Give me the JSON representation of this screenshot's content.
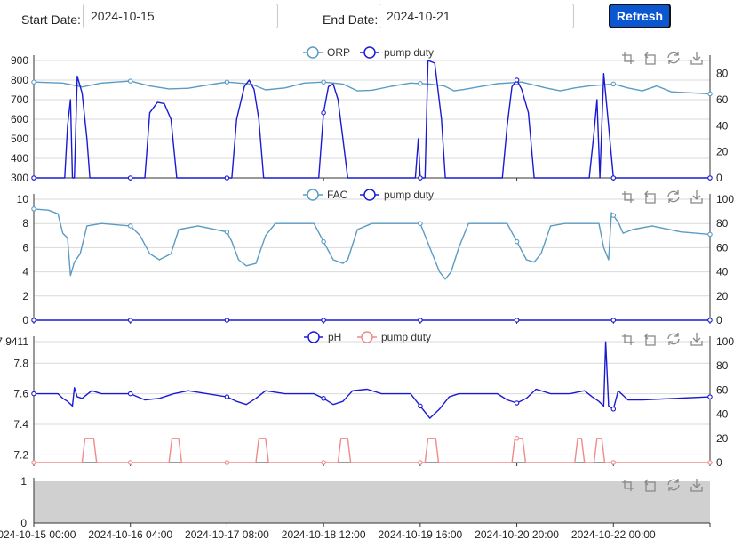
{
  "controls": {
    "start_label": "Start Date:",
    "start_value": "2024-10-15",
    "end_label": "End Date:",
    "end_value": "2024-10-21",
    "refresh_label": "Refresh"
  },
  "colors": {
    "orp": "#5b9bc4",
    "fac": "#5b9bc4",
    "ph": "#1a1ad4",
    "pump_blue": "#1a1ad4",
    "pump_pink": "#f08a8a",
    "grid": "#d9d9d9",
    "slider_fill": "#d0d0d0",
    "toolbox": "#888888"
  },
  "toolbox_icons": [
    "zoom-icon",
    "zoom-reset-icon",
    "restore-icon",
    "save-image-icon"
  ],
  "chart_data": [
    {
      "type": "line",
      "legend": [
        "ORP",
        "pump duty"
      ],
      "y_left_ticks": [
        "900",
        "800",
        "700",
        "600",
        "500",
        "400",
        "300"
      ],
      "y_left_range": [
        300,
        900
      ],
      "y_right_ticks": [
        "80",
        "60",
        "40",
        "20",
        "0"
      ],
      "y_right_range": [
        0,
        90
      ],
      "series": [
        {
          "name": "ORP",
          "axis": "left",
          "color": "#5b9bc4",
          "points": [
            [
              0,
              790
            ],
            [
              0.3,
              785
            ],
            [
              0.5,
              765
            ],
            [
              0.7,
              785
            ],
            [
              1,
              795
            ],
            [
              1.2,
              770
            ],
            [
              1.4,
              755
            ],
            [
              1.6,
              758
            ],
            [
              1.8,
              775
            ],
            [
              2,
              790
            ],
            [
              2.25,
              780
            ],
            [
              2.4,
              750
            ],
            [
              2.6,
              760
            ],
            [
              2.8,
              785
            ],
            [
              3,
              790
            ],
            [
              3.2,
              780
            ],
            [
              3.35,
              745
            ],
            [
              3.5,
              748
            ],
            [
              3.7,
              768
            ],
            [
              3.9,
              785
            ],
            [
              4.1,
              780
            ],
            [
              4.25,
              770
            ],
            [
              4.35,
              745
            ],
            [
              4.45,
              752
            ],
            [
              4.6,
              765
            ],
            [
              4.8,
              782
            ],
            [
              5.05,
              790
            ],
            [
              5.3,
              760
            ],
            [
              5.45,
              745
            ],
            [
              5.6,
              760
            ],
            [
              5.75,
              770
            ],
            [
              6,
              780
            ],
            [
              6.15,
              760
            ],
            [
              6.3,
              745
            ],
            [
              6.45,
              770
            ],
            [
              6.6,
              740
            ],
            [
              6.8,
              735
            ],
            [
              7,
              730
            ]
          ]
        },
        {
          "name": "pump duty",
          "axis": "right",
          "color": "#1a1ad4",
          "points": [
            [
              0,
              0
            ],
            [
              0.32,
              0
            ],
            [
              0.35,
              40
            ],
            [
              0.38,
              60
            ],
            [
              0.4,
              0
            ],
            [
              0.42,
              0
            ],
            [
              0.45,
              78
            ],
            [
              0.5,
              65
            ],
            [
              0.55,
              30
            ],
            [
              0.58,
              0
            ],
            [
              1.15,
              0
            ],
            [
              1.2,
              50
            ],
            [
              1.28,
              58
            ],
            [
              1.35,
              57
            ],
            [
              1.42,
              45
            ],
            [
              1.48,
              0
            ],
            [
              2.05,
              0
            ],
            [
              2.1,
              45
            ],
            [
              2.18,
              70
            ],
            [
              2.23,
              75
            ],
            [
              2.28,
              68
            ],
            [
              2.33,
              45
            ],
            [
              2.38,
              0
            ],
            [
              2.95,
              0
            ],
            [
              3.0,
              50
            ],
            [
              3.05,
              70
            ],
            [
              3.1,
              72
            ],
            [
              3.15,
              60
            ],
            [
              3.2,
              30
            ],
            [
              3.25,
              0
            ],
            [
              3.95,
              0
            ],
            [
              3.98,
              30
            ],
            [
              4.0,
              0
            ],
            [
              4.05,
              0
            ],
            [
              4.08,
              90
            ],
            [
              4.15,
              88
            ],
            [
              4.18,
              70
            ],
            [
              4.22,
              45
            ],
            [
              4.26,
              0
            ],
            [
              4.85,
              0
            ],
            [
              4.9,
              40
            ],
            [
              4.95,
              70
            ],
            [
              5.0,
              75
            ],
            [
              5.05,
              68
            ],
            [
              5.12,
              50
            ],
            [
              5.18,
              0
            ],
            [
              5.75,
              0
            ],
            [
              5.8,
              35
            ],
            [
              5.83,
              60
            ],
            [
              5.86,
              0
            ],
            [
              5.9,
              80
            ],
            [
              5.95,
              40
            ],
            [
              6.0,
              0
            ],
            [
              7,
              0
            ]
          ]
        }
      ]
    },
    {
      "type": "line",
      "legend": [
        "FAC",
        "pump duty"
      ],
      "y_left_ticks": [
        "10",
        "8",
        "6",
        "4",
        "2",
        "0"
      ],
      "y_left_range": [
        0,
        10
      ],
      "y_right_ticks": [
        "100",
        "80",
        "60",
        "40",
        "20",
        "0"
      ],
      "y_right_range": [
        0,
        100
      ],
      "series": [
        {
          "name": "FAC",
          "axis": "left",
          "color": "#5b9bc4",
          "points": [
            [
              0,
              9.2
            ],
            [
              0.15,
              9.1
            ],
            [
              0.25,
              8.8
            ],
            [
              0.3,
              7.2
            ],
            [
              0.35,
              6.8
            ],
            [
              0.38,
              3.7
            ],
            [
              0.42,
              4.8
            ],
            [
              0.48,
              5.5
            ],
            [
              0.55,
              7.8
            ],
            [
              0.7,
              8.0
            ],
            [
              1,
              7.8
            ],
            [
              1.1,
              7.0
            ],
            [
              1.2,
              5.5
            ],
            [
              1.3,
              5.0
            ],
            [
              1.42,
              5.5
            ],
            [
              1.5,
              7.5
            ],
            [
              1.7,
              7.8
            ],
            [
              2.0,
              7.3
            ],
            [
              2.05,
              6.5
            ],
            [
              2.12,
              5.0
            ],
            [
              2.2,
              4.5
            ],
            [
              2.3,
              4.7
            ],
            [
              2.4,
              7.0
            ],
            [
              2.5,
              8.0
            ],
            [
              2.9,
              8.0
            ],
            [
              3.0,
              6.5
            ],
            [
              3.1,
              5.0
            ],
            [
              3.2,
              4.7
            ],
            [
              3.25,
              5.0
            ],
            [
              3.35,
              7.5
            ],
            [
              3.5,
              8.0
            ],
            [
              4.0,
              8.0
            ],
            [
              4.1,
              6.0
            ],
            [
              4.2,
              4.0
            ],
            [
              4.26,
              3.4
            ],
            [
              4.32,
              4.0
            ],
            [
              4.4,
              6.0
            ],
            [
              4.5,
              8.0
            ],
            [
              4.9,
              8.0
            ],
            [
              5.0,
              6.5
            ],
            [
              5.1,
              5.0
            ],
            [
              5.18,
              4.8
            ],
            [
              5.25,
              5.5
            ],
            [
              5.35,
              7.8
            ],
            [
              5.5,
              8.0
            ],
            [
              5.85,
              8.0
            ],
            [
              5.9,
              6.0
            ],
            [
              5.95,
              5.0
            ],
            [
              5.98,
              8.9
            ],
            [
              6.05,
              8.1
            ],
            [
              6.1,
              7.2
            ],
            [
              6.2,
              7.5
            ],
            [
              6.4,
              7.8
            ],
            [
              6.7,
              7.3
            ],
            [
              7,
              7.1
            ]
          ]
        },
        {
          "name": "pump duty",
          "axis": "right",
          "color": "#1a1ad4",
          "points": [
            [
              0,
              0
            ],
            [
              7,
              0
            ]
          ]
        }
      ]
    },
    {
      "type": "line",
      "legend": [
        "pH",
        "pump duty"
      ],
      "y_left_ticks": [
        "7.9411",
        "7.8",
        "7.6",
        "7.4",
        "7.2"
      ],
      "y_left_range": [
        7.15,
        7.9411
      ],
      "y_right_ticks": [
        "100",
        "80",
        "60",
        "40",
        "20",
        "0"
      ],
      "y_right_range": [
        0,
        100
      ],
      "series": [
        {
          "name": "pH",
          "axis": "left",
          "color": "#1a1ad4",
          "points": [
            [
              0,
              7.6
            ],
            [
              0.25,
              7.6
            ],
            [
              0.3,
              7.57
            ],
            [
              0.35,
              7.55
            ],
            [
              0.4,
              7.52
            ],
            [
              0.42,
              7.64
            ],
            [
              0.45,
              7.58
            ],
            [
              0.5,
              7.57
            ],
            [
              0.6,
              7.62
            ],
            [
              0.7,
              7.6
            ],
            [
              1.0,
              7.6
            ],
            [
              1.15,
              7.56
            ],
            [
              1.3,
              7.57
            ],
            [
              1.45,
              7.6
            ],
            [
              1.6,
              7.62
            ],
            [
              2.0,
              7.58
            ],
            [
              2.1,
              7.55
            ],
            [
              2.2,
              7.53
            ],
            [
              2.3,
              7.57
            ],
            [
              2.4,
              7.62
            ],
            [
              2.6,
              7.6
            ],
            [
              2.9,
              7.6
            ],
            [
              3.0,
              7.57
            ],
            [
              3.1,
              7.53
            ],
            [
              3.2,
              7.55
            ],
            [
              3.3,
              7.62
            ],
            [
              3.45,
              7.63
            ],
            [
              3.6,
              7.6
            ],
            [
              3.9,
              7.6
            ],
            [
              4.0,
              7.52
            ],
            [
              4.1,
              7.44
            ],
            [
              4.2,
              7.5
            ],
            [
              4.3,
              7.58
            ],
            [
              4.4,
              7.6
            ],
            [
              4.8,
              7.6
            ],
            [
              4.9,
              7.56
            ],
            [
              5.0,
              7.54
            ],
            [
              5.1,
              7.57
            ],
            [
              5.2,
              7.63
            ],
            [
              5.35,
              7.6
            ],
            [
              5.55,
              7.6
            ],
            [
              5.7,
              7.62
            ],
            [
              5.78,
              7.58
            ],
            [
              5.85,
              7.55
            ],
            [
              5.9,
              7.52
            ],
            [
              5.92,
              7.94
            ],
            [
              5.95,
              7.52
            ],
            [
              6.0,
              7.5
            ],
            [
              6.05,
              7.62
            ],
            [
              6.15,
              7.56
            ],
            [
              6.3,
              7.56
            ],
            [
              7,
              7.58
            ]
          ]
        },
        {
          "name": "pump duty",
          "axis": "right",
          "color": "#f08a8a",
          "points": [
            [
              0,
              0
            ],
            [
              0.5,
              0
            ],
            [
              0.53,
              20
            ],
            [
              0.62,
              20
            ],
            [
              0.65,
              0
            ],
            [
              1.4,
              0
            ],
            [
              1.43,
              20
            ],
            [
              1.5,
              20
            ],
            [
              1.53,
              0
            ],
            [
              2.3,
              0
            ],
            [
              2.33,
              20
            ],
            [
              2.4,
              20
            ],
            [
              2.43,
              0
            ],
            [
              3.15,
              0
            ],
            [
              3.18,
              20
            ],
            [
              3.25,
              20
            ],
            [
              3.28,
              0
            ],
            [
              4.05,
              0
            ],
            [
              4.08,
              20
            ],
            [
              4.16,
              20
            ],
            [
              4.19,
              0
            ],
            [
              4.95,
              0
            ],
            [
              4.98,
              20
            ],
            [
              5.06,
              20
            ],
            [
              5.09,
              0
            ],
            [
              5.6,
              0
            ],
            [
              5.63,
              20
            ],
            [
              5.67,
              20
            ],
            [
              5.7,
              0
            ],
            [
              5.8,
              0
            ],
            [
              5.83,
              20
            ],
            [
              5.88,
              20
            ],
            [
              5.91,
              0
            ],
            [
              7,
              0
            ]
          ]
        }
      ]
    }
  ],
  "x_axis": {
    "ticks": [
      "2024-10-15 00:00",
      "2024-10-16 04:00",
      "2024-10-17 08:00",
      "2024-10-18 12:00",
      "2024-10-19 16:00",
      "2024-10-20 20:00",
      "2024-10-22 00:00"
    ]
  },
  "slider": {
    "y_ticks": [
      "1",
      "0"
    ]
  }
}
